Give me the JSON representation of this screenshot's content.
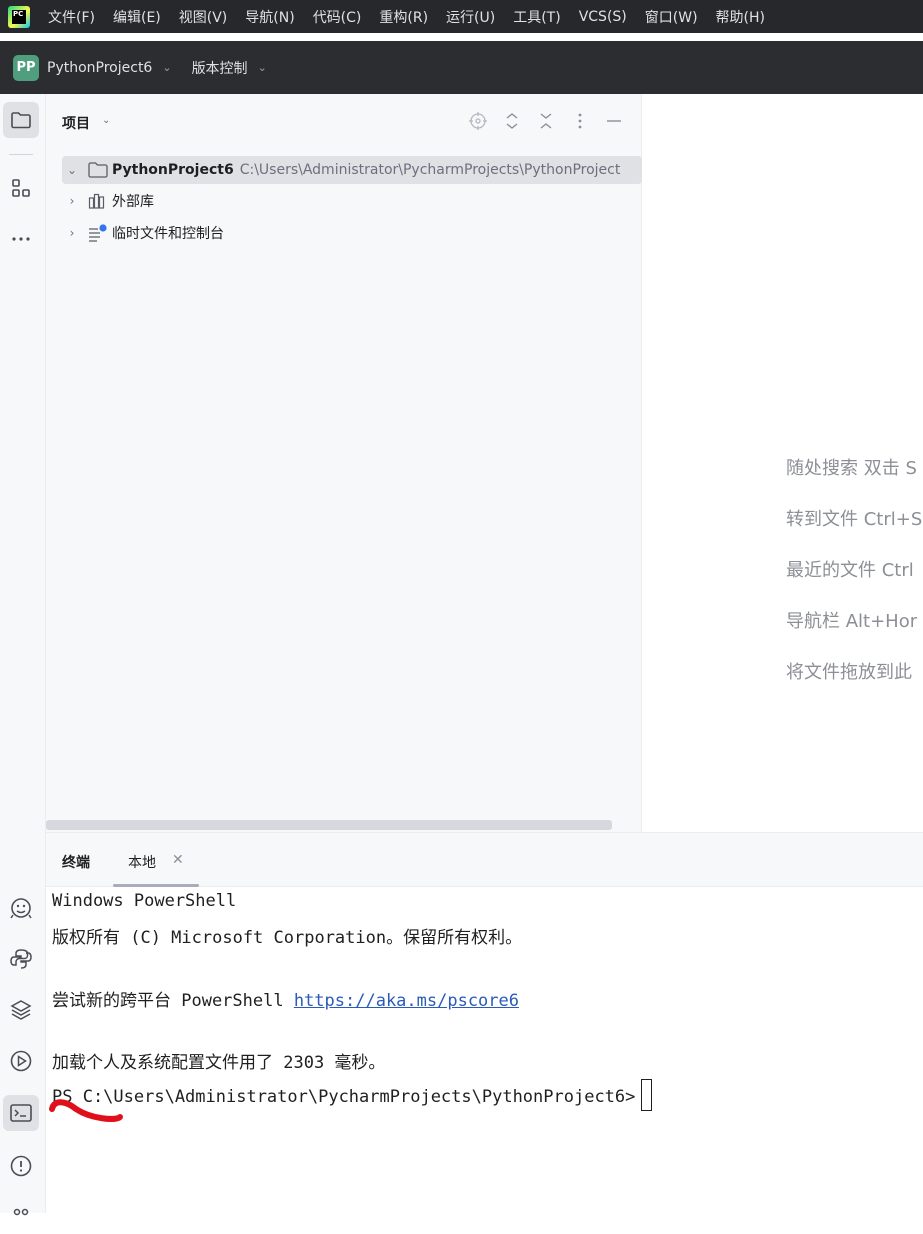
{
  "menubar": {
    "logo_text": "PC",
    "items": [
      "文件(F)",
      "编辑(E)",
      "视图(V)",
      "导航(N)",
      "代码(C)",
      "重构(R)",
      "运行(U)",
      "工具(T)",
      "VCS(S)",
      "窗口(W)",
      "帮助(H)"
    ]
  },
  "toolbar": {
    "project_initials": "PP",
    "project_name": "PythonProject6",
    "vcs_label": "版本控制"
  },
  "project_panel": {
    "title": "项目",
    "tree": [
      {
        "label": "PythonProject6",
        "path": "C:\\Users\\Administrator\\PycharmProjects\\PythonProject",
        "icon": "folder-icon",
        "expanded": true
      },
      {
        "label": "外部库",
        "icon": "library-icon",
        "expanded": false
      },
      {
        "label": "临时文件和控制台",
        "icon": "scratch-icon",
        "expanded": false
      }
    ]
  },
  "editor": {
    "hints": [
      "随处搜索 双击 S",
      "转到文件 Ctrl+S",
      "最近的文件 Ctrl",
      "导航栏 Alt+Hor",
      "将文件拖放到此"
    ]
  },
  "terminal": {
    "title": "终端",
    "tab_label": "本地",
    "lines": {
      "l1": "Windows PowerShell",
      "l2": "版权所有 (C) Microsoft Corporation。保留所有权利。",
      "l3_prefix": "尝试新的跨平台 PowerShell ",
      "l3_link": "https://aka.ms/pscore6",
      "l4": "加载个人及系统配置文件用了 2303 毫秒。",
      "prompt": "PS C:\\Users\\Administrator\\PycharmProjects\\PythonProject6>"
    }
  },
  "colors": {
    "menubar_bg": "#27282c",
    "toolbar_bg": "#2b2d30",
    "project_avatar": "#4f9e7e",
    "panel_bg": "#f7f8fa",
    "link": "#2a5bb8",
    "annotation_mark": "#e0101a"
  }
}
